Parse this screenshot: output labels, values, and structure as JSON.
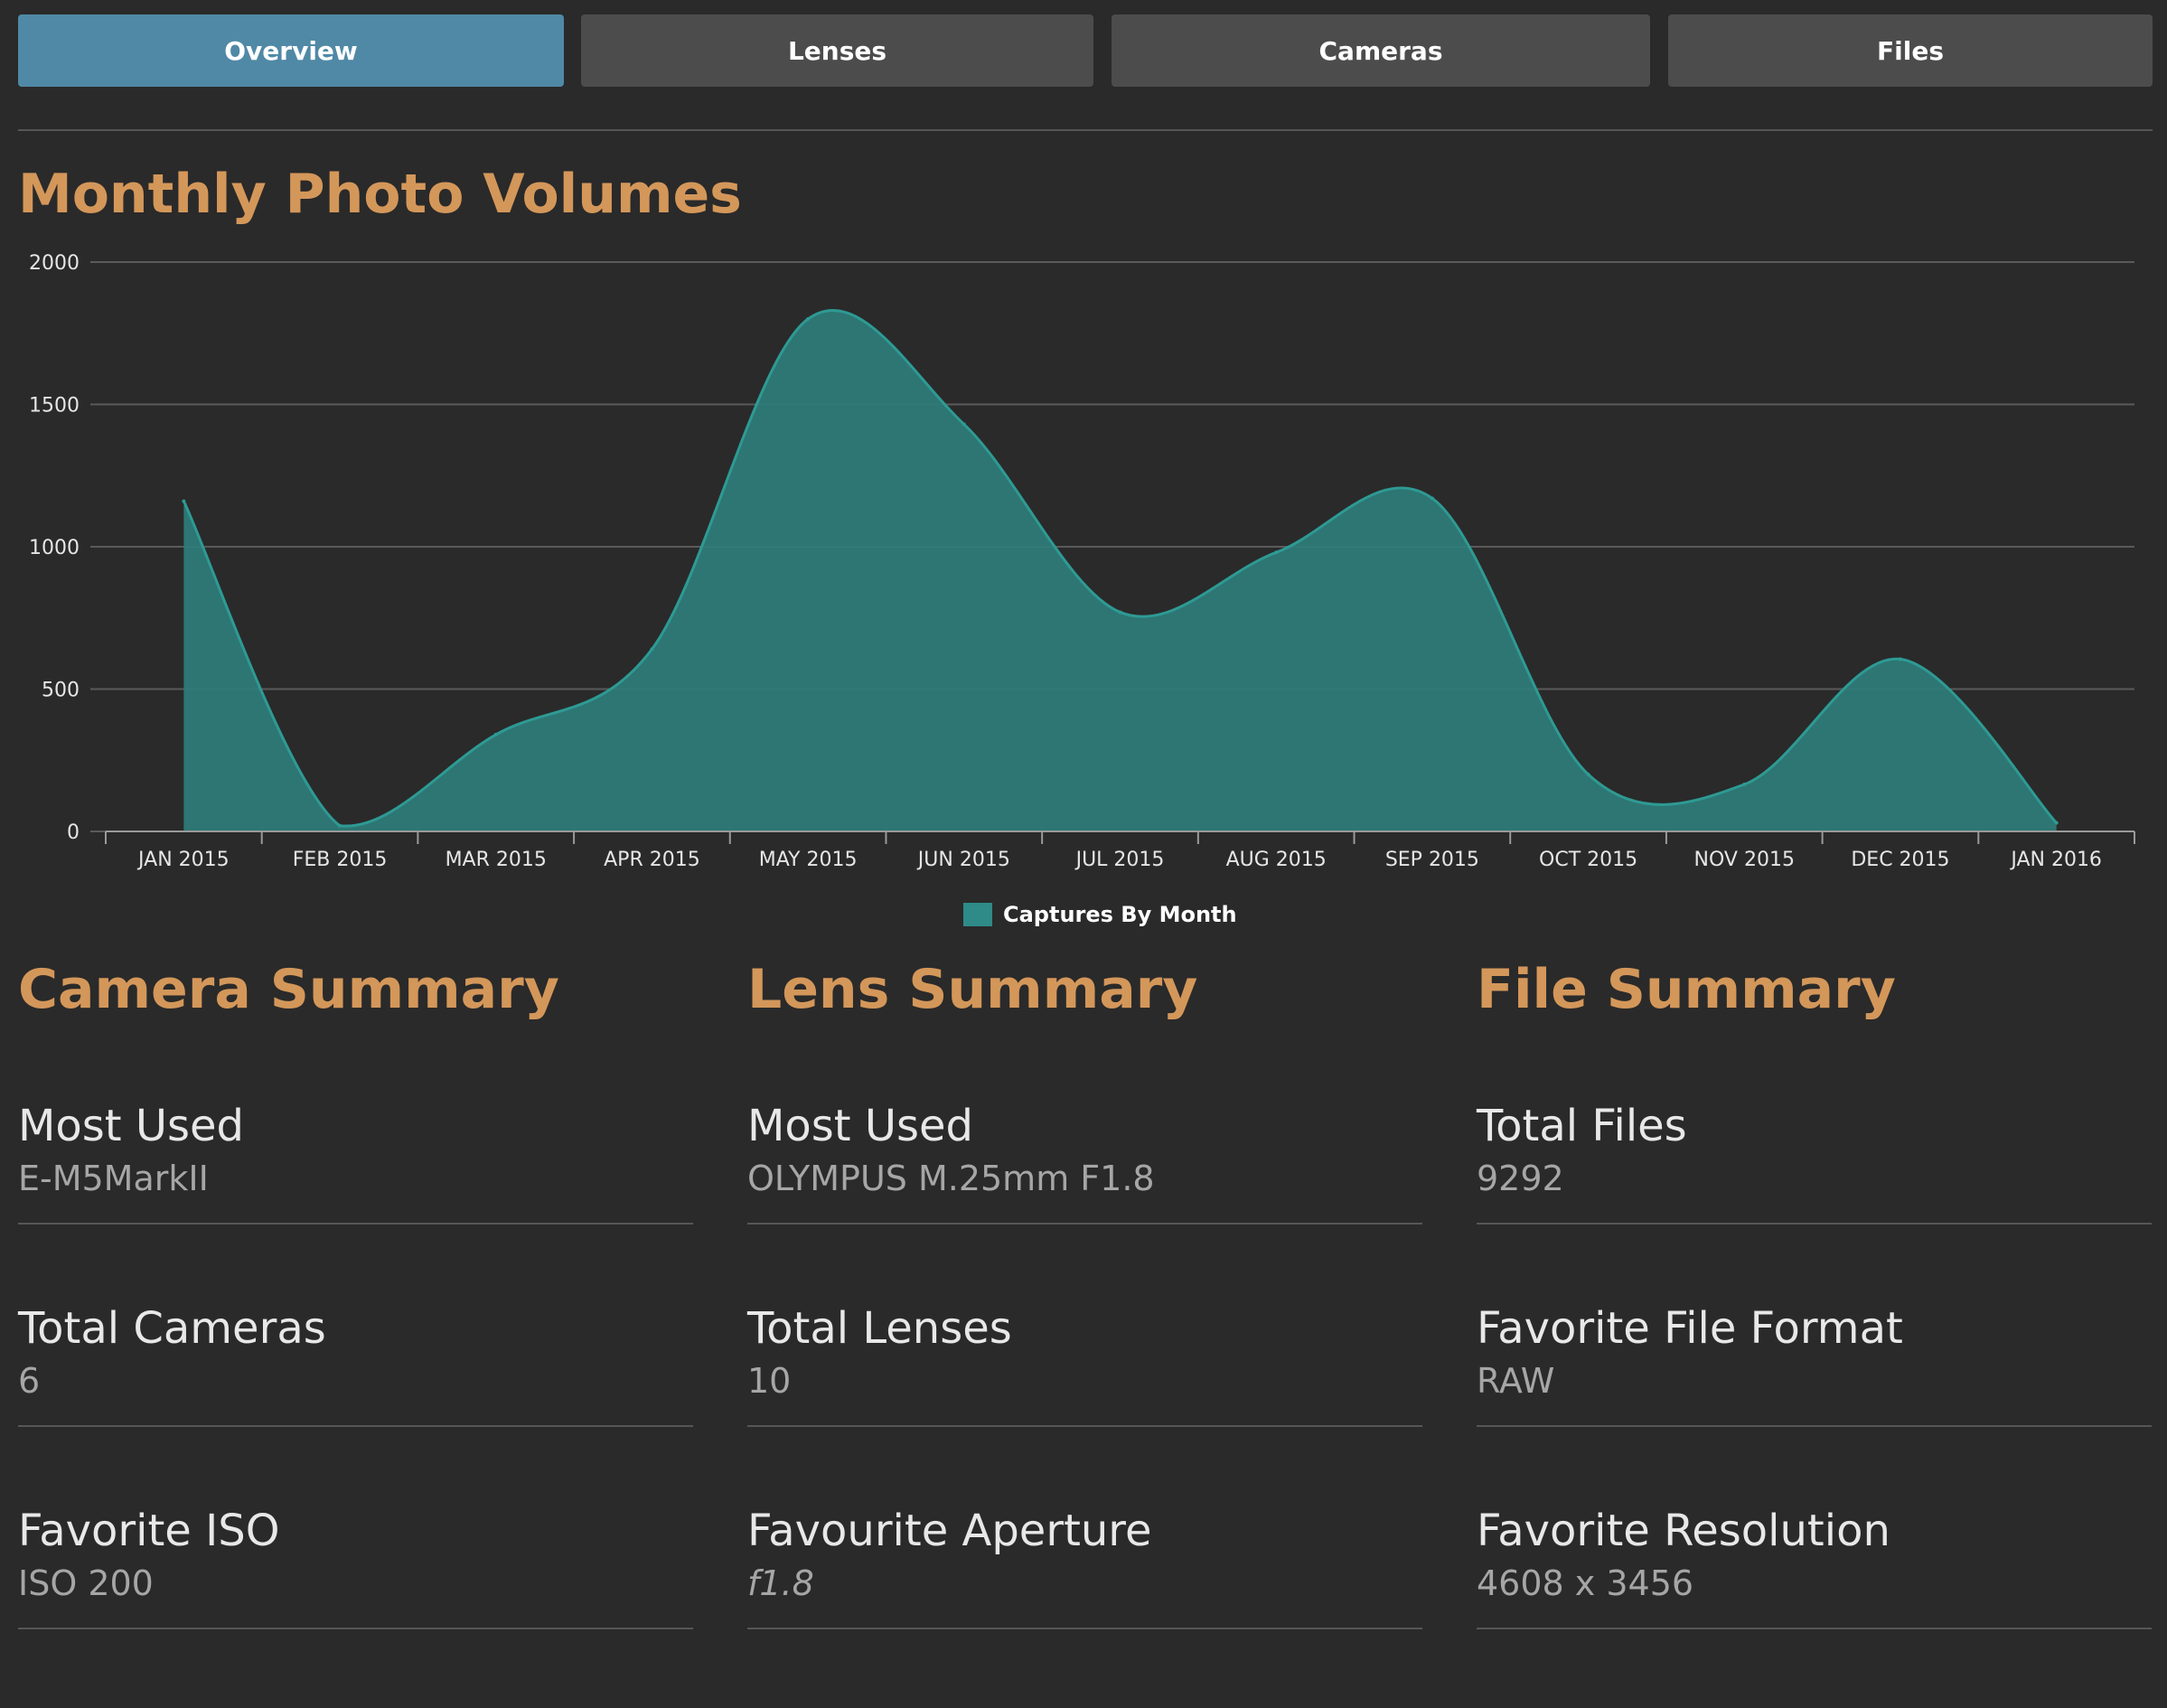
{
  "tabs": [
    {
      "label": "Overview",
      "active": true
    },
    {
      "label": "Lenses",
      "active": false
    },
    {
      "label": "Cameras",
      "active": false
    },
    {
      "label": "Files",
      "active": false
    }
  ],
  "chart": {
    "title": "Monthly Photo Volumes",
    "legend_label": "Captures By Month"
  },
  "chart_data": {
    "type": "area",
    "title": "Monthly Photo Volumes",
    "categories": [
      "JAN 2015",
      "FEB 2015",
      "MAR 2015",
      "APR 2015",
      "MAY 2015",
      "JUN 2015",
      "JUL 2015",
      "AUG 2015",
      "SEP 2015",
      "OCT 2015",
      "NOV 2015",
      "DEC 2015",
      "JAN 2016"
    ],
    "series": [
      {
        "name": "Captures By Month",
        "values": [
          1160,
          20,
          340,
          640,
          1800,
          1430,
          770,
          980,
          1170,
          200,
          165,
          605,
          30
        ]
      }
    ],
    "ylim": [
      0,
      2000
    ],
    "yticks": [
      0,
      500,
      1000,
      1500,
      2000
    ],
    "grid": true,
    "legend_position": "bottom",
    "colors": {
      "fill": "#2e7d7a",
      "stroke": "#2e9a94"
    }
  },
  "camera_summary": {
    "title": "Camera Summary",
    "stats": [
      {
        "label": "Most Used",
        "value": "E-M5MarkII"
      },
      {
        "label": "Total Cameras",
        "value": "6"
      },
      {
        "label": "Favorite ISO",
        "value": "ISO 200"
      }
    ]
  },
  "lens_summary": {
    "title": "Lens Summary",
    "stats": [
      {
        "label": "Most Used",
        "value": "OLYMPUS M.25mm F1.8"
      },
      {
        "label": "Total Lenses",
        "value": "10"
      },
      {
        "label": "Favourite Aperture",
        "value": "f1.8"
      }
    ]
  },
  "file_summary": {
    "title": "File Summary",
    "stats": [
      {
        "label": "Total Files",
        "value": "9292"
      },
      {
        "label": "Favorite File Format",
        "value": "RAW"
      },
      {
        "label": "Favorite Resolution",
        "value": "4608 x 3456"
      }
    ]
  },
  "colors": {
    "background": "#2a2a2a",
    "accent_heading": "#d4975a",
    "tab_active": "#5089a6",
    "tab_inactive": "#4c4c4c"
  }
}
